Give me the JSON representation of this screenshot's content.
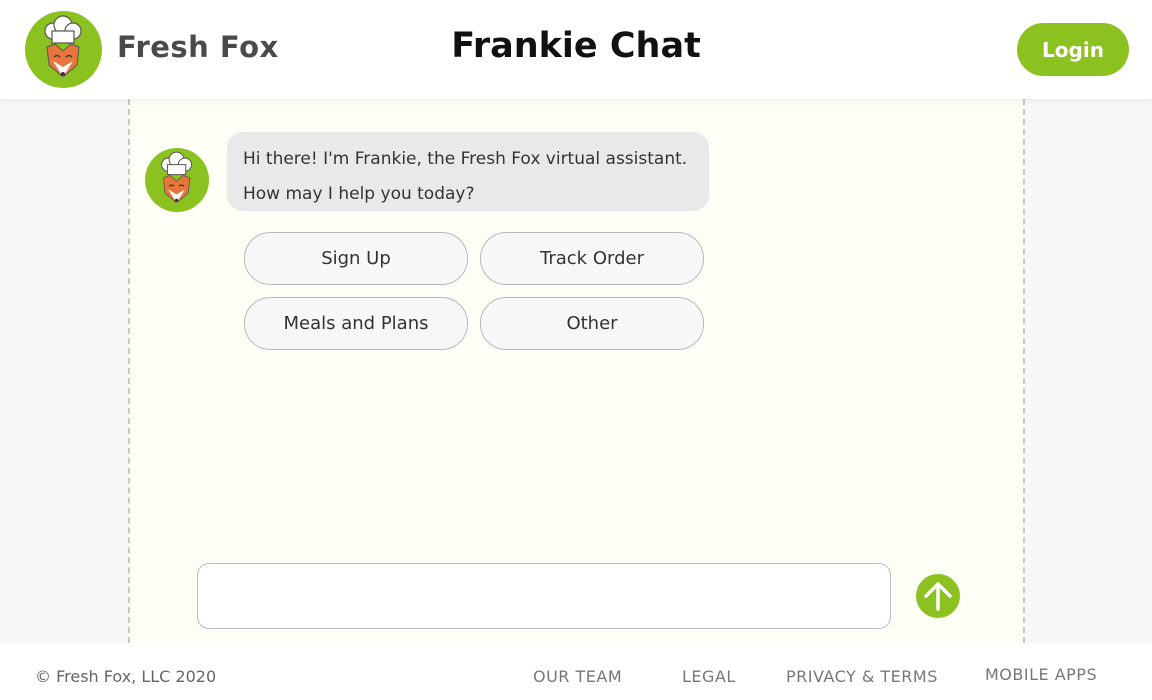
{
  "header": {
    "brand_name": "Fresh Fox",
    "title": "Frankie Chat",
    "login_label": "Login"
  },
  "chat": {
    "bot_message_lines": [
      "Hi there! I'm Frankie, the Fresh Fox virtual assistant.",
      "How may I help you today?"
    ],
    "options": [
      "Sign Up",
      "Track Order",
      "Meals and Plans",
      "Other"
    ],
    "input": {
      "value": "",
      "placeholder": ""
    }
  },
  "footer": {
    "copyright": "© Fresh Fox, LLC 2020",
    "links": [
      "OUR TEAM",
      "LEGAL",
      "PRIVACY & TERMS",
      "MOBILE APPS"
    ]
  },
  "icons": {
    "logo": "fox-chef-logo-icon",
    "avatar": "fox-chef-avatar-icon",
    "send": "arrow-up-icon"
  },
  "colors": {
    "accent": "#8cc21f",
    "chat_background": "#fdfef5",
    "bubble": "#e9e9e9",
    "fox_orange": "#e8763a"
  }
}
